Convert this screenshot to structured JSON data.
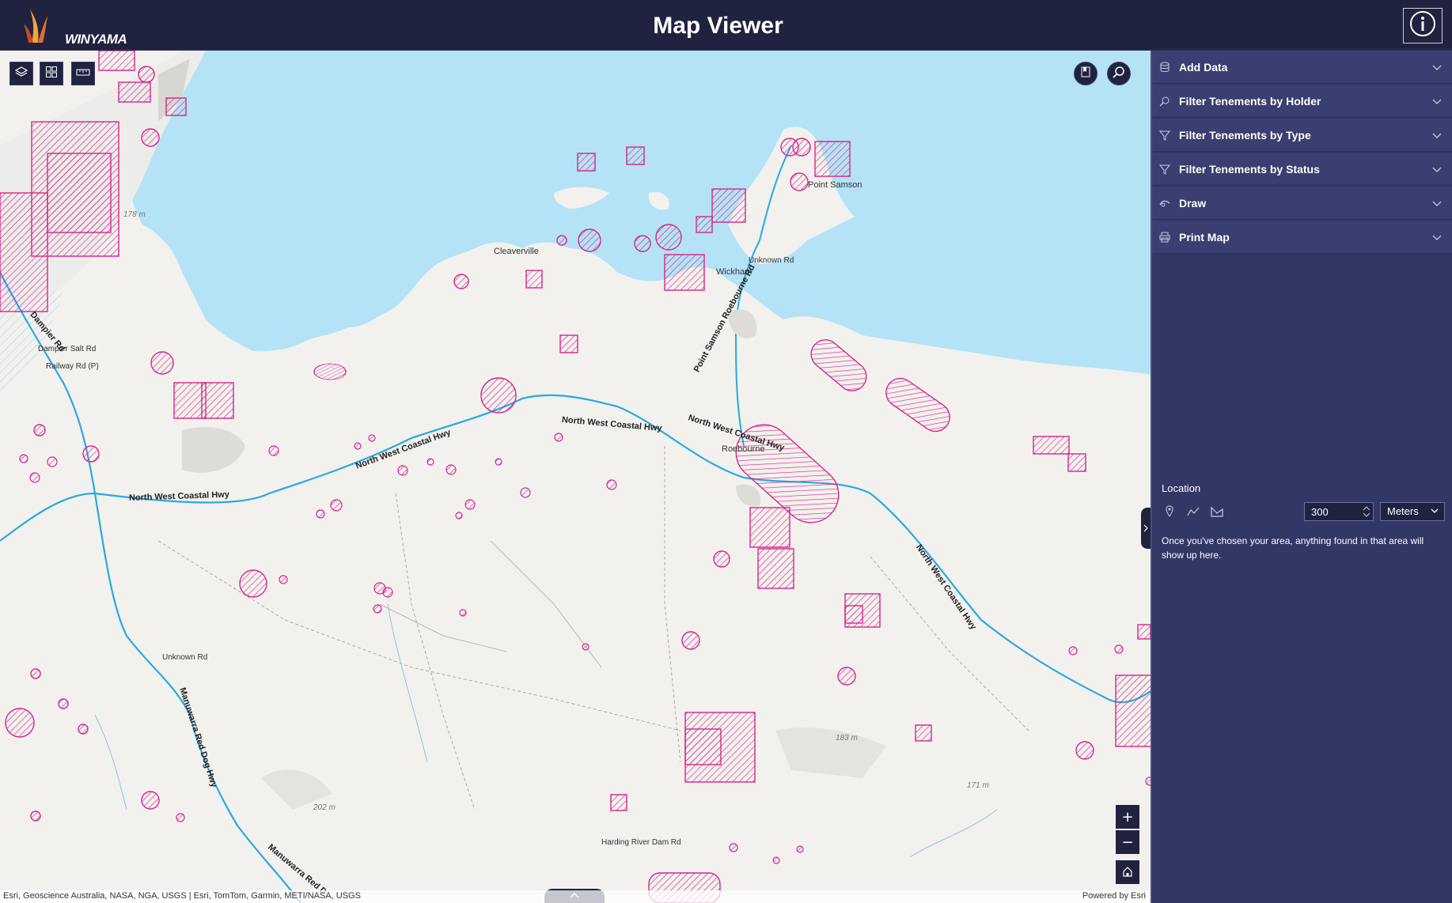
{
  "header": {
    "logo_text": "WINYAMA",
    "title": "Map Viewer",
    "info_icon": "info-icon"
  },
  "map": {
    "toolbar_left": [
      "layers-icon",
      "basemap-gallery-icon",
      "measure-icon"
    ],
    "toolbar_right": [
      "bookmark-icon",
      "search-icon"
    ],
    "zoom_in": "+",
    "zoom_out": "−",
    "home_icon": "home-icon",
    "labels": {
      "cleaverville": "Cleaverville",
      "point_samson": "Point Samson",
      "roebourne": "Roebourne",
      "wickham": "Wickham",
      "harding": "Harding River Dam Rd",
      "unknown_rd_1": "Unknown Rd",
      "unknown_rd_2": "Unknown Rd",
      "dampier_salt_rd": "Dampier Salt Rd",
      "railway_rd": "Railway Rd (P)",
      "elev_178": "178 m",
      "elev_183": "183 m",
      "elev_202": "202 m",
      "elev_171": "171 m"
    },
    "roads": {
      "nwch_1": "North West Coastal Hwy",
      "nwch_2": "North West Coastal Hwy",
      "nwch_3": "North West Coastal Hwy",
      "nwch_4": "North West Coastal Hwy",
      "nwch_5": "North West Coastal Hwy",
      "pt_samson_rd": "Point Samson Roebourne Rd",
      "dampier_rd": "Dampier Rd",
      "manuwarra": "Manuwarra Red Dog Hwy",
      "manuwarra_2": "Manuwarra Red D"
    },
    "attribution": "Esri, Geoscience Australia, NASA, NGA, USGS | Esri, TomTom, Garmin, METI/NASA, USGS",
    "powered_by": "Powered by Esri"
  },
  "panel": {
    "sections": [
      {
        "label": "Add Data",
        "icon": "database-icon"
      },
      {
        "label": "Filter Tenements by Holder",
        "icon": "search-filter-icon"
      },
      {
        "label": "Filter Tenements by Type",
        "icon": "filter-icon"
      },
      {
        "label": "Filter Tenements by Status",
        "icon": "filter-icon"
      },
      {
        "label": "Draw",
        "icon": "draw-icon"
      },
      {
        "label": "Print Map",
        "icon": "print-icon"
      }
    ],
    "location": {
      "label": "Location",
      "tools": [
        "point-icon",
        "polyline-icon",
        "polygon-icon"
      ],
      "distance_value": "300",
      "unit": "Meters",
      "message": "Once you've chosen your area, anything found in that area will show up here."
    }
  },
  "colors": {
    "header_bg": "#1f2340",
    "panel_bg": "#333766",
    "tenement": "#d6278a",
    "water": "#b4e2f7",
    "road": "#29a9e0"
  }
}
